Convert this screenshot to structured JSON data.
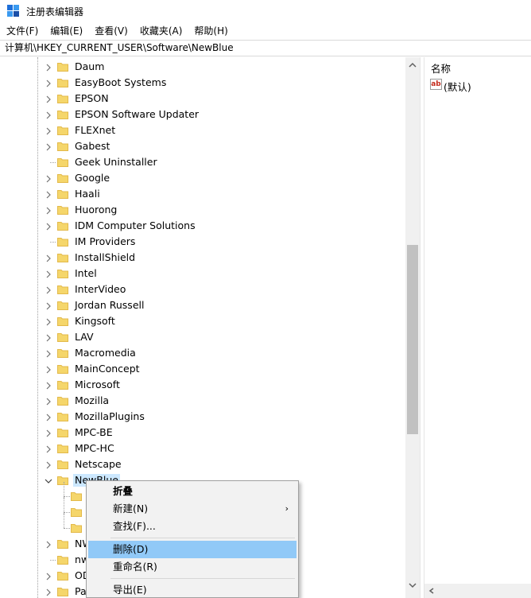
{
  "window": {
    "title": "注册表编辑器",
    "icon": "regedit-icon"
  },
  "menubar": [
    {
      "label": "文件(F)"
    },
    {
      "label": "编辑(E)"
    },
    {
      "label": "查看(V)"
    },
    {
      "label": "收藏夹(A)"
    },
    {
      "label": "帮助(H)"
    }
  ],
  "address": {
    "path": "计算机\\HKEY_CURRENT_USER\\Software\\NewBlue"
  },
  "tree": {
    "items": [
      {
        "label": "Daum",
        "expandable": true
      },
      {
        "label": "EasyBoot Systems",
        "expandable": true
      },
      {
        "label": "EPSON",
        "expandable": true
      },
      {
        "label": "EPSON Software Updater",
        "expandable": true
      },
      {
        "label": "FLEXnet",
        "expandable": true
      },
      {
        "label": "Gabest",
        "expandable": true
      },
      {
        "label": "Geek Uninstaller",
        "expandable": false
      },
      {
        "label": "Google",
        "expandable": true
      },
      {
        "label": "Haali",
        "expandable": true
      },
      {
        "label": "Huorong",
        "expandable": true
      },
      {
        "label": "IDM Computer Solutions",
        "expandable": true
      },
      {
        "label": "IM Providers",
        "expandable": false
      },
      {
        "label": "InstallShield",
        "expandable": true
      },
      {
        "label": "Intel",
        "expandable": true
      },
      {
        "label": "InterVideo",
        "expandable": true
      },
      {
        "label": "Jordan Russell",
        "expandable": true
      },
      {
        "label": "Kingsoft",
        "expandable": true
      },
      {
        "label": "LAV",
        "expandable": true
      },
      {
        "label": "Macromedia",
        "expandable": true
      },
      {
        "label": "MainConcept",
        "expandable": true
      },
      {
        "label": "Microsoft",
        "expandable": true
      },
      {
        "label": "Mozilla",
        "expandable": true
      },
      {
        "label": "MozillaPlugins",
        "expandable": true
      },
      {
        "label": "MPC-BE",
        "expandable": true
      },
      {
        "label": "MPC-HC",
        "expandable": true
      },
      {
        "label": "Netscape",
        "expandable": true
      },
      {
        "label": "NewBlue",
        "expandable": true,
        "expanded": true,
        "selected": true
      },
      {
        "label": "",
        "child": true
      },
      {
        "label": "",
        "child": true
      },
      {
        "label": "",
        "child": true
      },
      {
        "label": "NW",
        "expandable": true
      },
      {
        "label": "nw",
        "expandable": false
      },
      {
        "label": "OD",
        "expandable": true
      },
      {
        "label": "Pa",
        "expandable": true
      }
    ]
  },
  "list": {
    "column_name": "名称",
    "values": [
      {
        "icon": "string-value-icon",
        "icon_text": "ab",
        "name": "(默认)"
      }
    ]
  },
  "context_menu": {
    "items": [
      {
        "label": "折叠",
        "bold": true
      },
      {
        "label": "新建(N)",
        "submenu": true,
        "arrow": "›"
      },
      {
        "label": "查找(F)..."
      },
      {
        "separator": true
      },
      {
        "label": "删除(D)",
        "highlighted": true
      },
      {
        "label": "重命名(R)"
      },
      {
        "separator": true
      },
      {
        "label": "导出(E)"
      }
    ]
  },
  "colors": {
    "folder": "#f5d66b",
    "folder_dark": "#e3b94a",
    "selection": "#cce8ff",
    "menu_highlight": "#91c9f7",
    "menu_bg": "#f2f2f2"
  }
}
